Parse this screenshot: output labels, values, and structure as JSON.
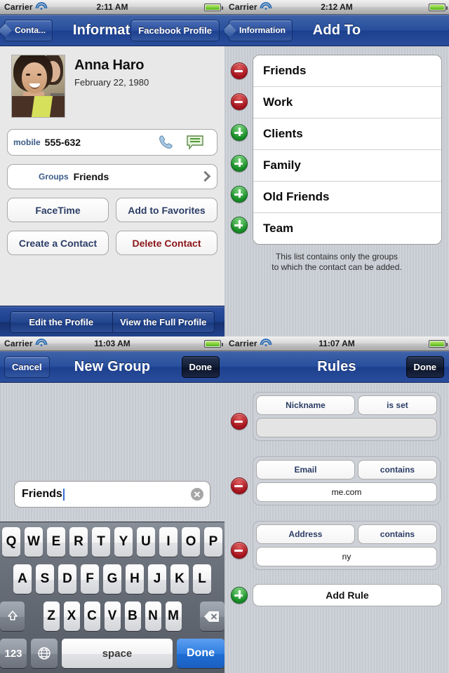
{
  "panels": {
    "information": {
      "status": {
        "carrier": "Carrier",
        "time": "2:11 AM"
      },
      "nav": {
        "back": "Conta...",
        "title": "Information",
        "right": "Facebook Profile"
      },
      "contact": {
        "name": "Anna Haro",
        "birthday": "February 22, 1980"
      },
      "phone": {
        "label": "mobile",
        "value": "555-632",
        "call_icon": "phone-icon",
        "message_icon": "message-bubble-icon"
      },
      "groups": {
        "label": "Groups",
        "value": "Friends",
        "chevron": "chevron-right-icon"
      },
      "buttons": {
        "facetime": "FaceTime",
        "add_to_favorites": "Add to Favorites",
        "create_contact": "Create a Contact",
        "delete_contact": "Delete Contact"
      },
      "toolbar": {
        "edit": "Edit the Profile",
        "view": "View the Full Profile"
      },
      "colors": {
        "delete": "#8b1418",
        "accent": "#2b3d66"
      }
    },
    "add_to": {
      "status": {
        "carrier": "Carrier",
        "time": "2:12 AM"
      },
      "nav": {
        "back": "Information",
        "title": "Add To"
      },
      "groups": [
        {
          "name": "Friends",
          "action": "remove",
          "icon": "minus-circle-icon"
        },
        {
          "name": "Work",
          "action": "remove",
          "icon": "minus-circle-icon"
        },
        {
          "name": "Clients",
          "action": "add",
          "icon": "plus-circle-icon"
        },
        {
          "name": "Family",
          "action": "add",
          "icon": "plus-circle-icon"
        },
        {
          "name": "Old Friends",
          "action": "add",
          "icon": "plus-circle-icon"
        },
        {
          "name": "Team",
          "action": "add",
          "icon": "plus-circle-icon"
        }
      ],
      "note_line1": "This list contains only the groups",
      "note_line2": "to which the contact can be added."
    },
    "new_group": {
      "status": {
        "carrier": "Carrier",
        "time": "11:03 AM"
      },
      "nav": {
        "cancel": "Cancel",
        "title": "New Group",
        "done": "Done"
      },
      "field": {
        "value": "Friends",
        "clear_icon": "clear-circle-icon"
      },
      "keyboard": {
        "row1": [
          "Q",
          "W",
          "E",
          "R",
          "T",
          "Y",
          "U",
          "I",
          "O",
          "P"
        ],
        "row2": [
          "A",
          "S",
          "D",
          "F",
          "G",
          "H",
          "J",
          "K",
          "L"
        ],
        "row3": [
          "Z",
          "X",
          "C",
          "V",
          "B",
          "N",
          "M"
        ],
        "shift_icon": "shift-arrow-icon",
        "backspace_icon": "backspace-icon",
        "numbers_key": "123",
        "globe_icon": "globe-icon",
        "space_key": "space",
        "done_key": "Done"
      }
    },
    "rules": {
      "status": {
        "carrier": "Carrier",
        "time": "11:07 AM"
      },
      "nav": {
        "title": "Rules",
        "done": "Done"
      },
      "rules": [
        {
          "field": "Nickname",
          "operator": "is set",
          "value": "",
          "action": "remove",
          "icon": "minus-circle-icon"
        },
        {
          "field": "Email",
          "operator": "contains",
          "value": "me.com",
          "action": "remove",
          "icon": "minus-circle-icon"
        },
        {
          "field": "Address",
          "operator": "contains",
          "value": "ny",
          "action": "remove",
          "icon": "minus-circle-icon"
        }
      ],
      "add_rule": {
        "label": "Add Rule",
        "icon": "plus-circle-icon"
      }
    }
  }
}
